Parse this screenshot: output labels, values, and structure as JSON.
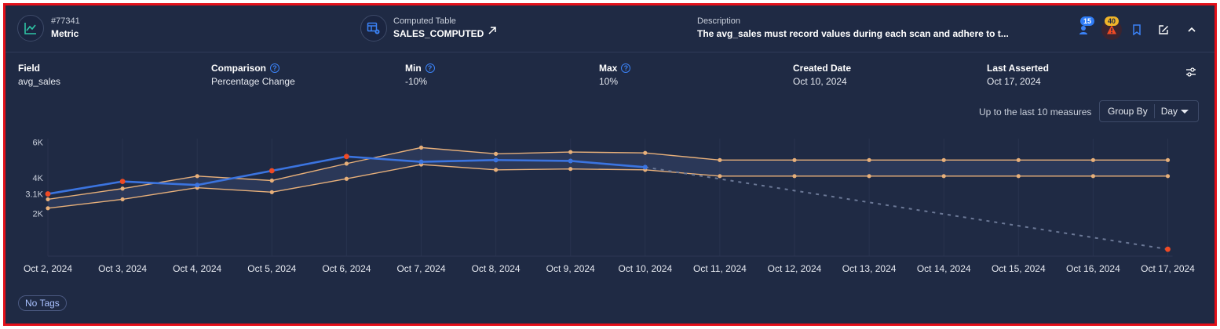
{
  "header": {
    "metric_id": "#77341",
    "metric_label": "Metric",
    "table_caption": "Computed Table",
    "table_name": "SALES_COMPUTED",
    "description_caption": "Description",
    "description_text": "The avg_sales must record values during each scan and adhere to t...",
    "badge_info_count": "15",
    "badge_alert_count": "40"
  },
  "props": {
    "field_label": "Field",
    "field_value": "avg_sales",
    "comparison_label": "Comparison",
    "comparison_value": "Percentage Change",
    "min_label": "Min",
    "min_value": "-10%",
    "max_label": "Max",
    "max_value": "10%",
    "created_label": "Created Date",
    "created_value": "Oct 10, 2024",
    "asserted_label": "Last Asserted",
    "asserted_value": "Oct 17, 2024"
  },
  "controls": {
    "measures_text": "Up to the last 10 measures",
    "group_by_label": "Group By",
    "group_by_value": "Day"
  },
  "tags": {
    "empty_label": "No Tags"
  },
  "colors": {
    "metric_line": "#3b74e0",
    "threshold_line": "#e8b07a",
    "anomaly": "#ef4a24",
    "band_fill": "#3a4a70",
    "background": "#1f2a44"
  },
  "chart_data": {
    "type": "line",
    "categories": [
      "Oct 2, 2024",
      "Oct 3, 2024",
      "Oct 4, 2024",
      "Oct 5, 2024",
      "Oct 6, 2024",
      "Oct 7, 2024",
      "Oct 8, 2024",
      "Oct 9, 2024",
      "Oct 10, 2024",
      "Oct 11, 2024",
      "Oct 12, 2024",
      "Oct 13, 2024",
      "Oct 14, 2024",
      "Oct 15, 2024",
      "Oct 16, 2024",
      "Oct 17, 2024"
    ],
    "y_ticks": [
      {
        "value": 2000,
        "label": "2K"
      },
      {
        "value": 3100,
        "label": "3.1K"
      },
      {
        "value": 4000,
        "label": "4K"
      },
      {
        "value": 6000,
        "label": "6K"
      }
    ],
    "ylim": [
      -300,
      6200
    ],
    "series": [
      {
        "role": "metric",
        "values": [
          3100,
          3800,
          3600,
          4400,
          5200,
          4900,
          5000,
          4950,
          4600,
          null,
          null,
          null,
          null,
          null,
          null,
          null
        ]
      },
      {
        "role": "upper",
        "values": [
          2800,
          3400,
          4100,
          3850,
          4800,
          5700,
          5350,
          5450,
          5400,
          5000,
          5000,
          5000,
          5000,
          5000,
          5000,
          5000
        ]
      },
      {
        "role": "lower",
        "values": [
          2300,
          2800,
          3450,
          3200,
          3950,
          4750,
          4450,
          4500,
          4450,
          4100,
          4100,
          4100,
          4100,
          4100,
          4100,
          4100
        ]
      },
      {
        "role": "projection",
        "values": [
          null,
          null,
          null,
          null,
          null,
          null,
          null,
          null,
          4600,
          null,
          null,
          null,
          null,
          null,
          null,
          0
        ]
      }
    ],
    "anomalies": [
      {
        "x": "Oct 2, 2024",
        "y": 3100
      },
      {
        "x": "Oct 3, 2024",
        "y": 3800
      },
      {
        "x": "Oct 5, 2024",
        "y": 4400
      },
      {
        "x": "Oct 6, 2024",
        "y": 5200
      },
      {
        "x": "Oct 17, 2024",
        "y": 0
      }
    ],
    "grid": true
  }
}
